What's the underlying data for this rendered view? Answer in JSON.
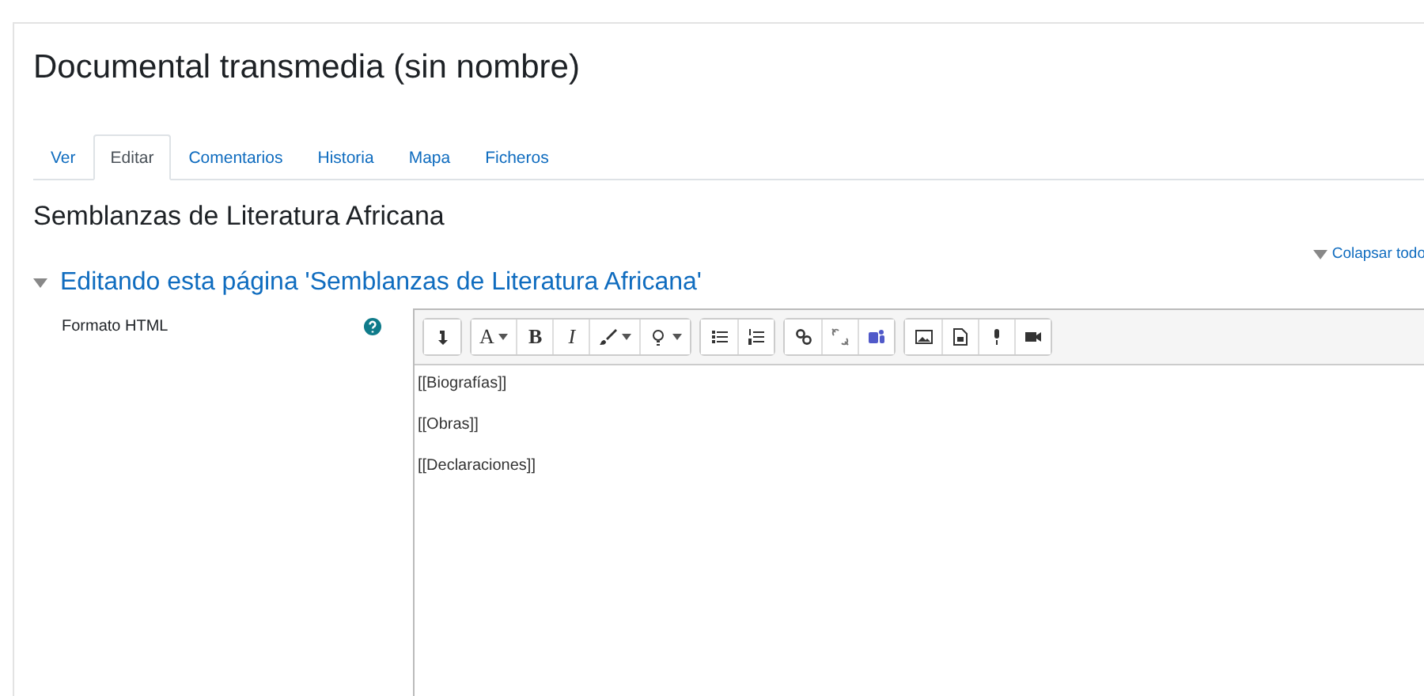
{
  "page_title": "Documental transmedia (sin nombre)",
  "tabs": [
    {
      "label": "Ver",
      "selected": false
    },
    {
      "label": "Editar",
      "selected": true
    },
    {
      "label": "Comentarios",
      "selected": false
    },
    {
      "label": "Historia",
      "selected": false
    },
    {
      "label": "Mapa",
      "selected": false
    },
    {
      "label": "Ficheros",
      "selected": false
    }
  ],
  "section_title": "Semblanzas de Literatura Africana",
  "collapse_link": "Colapsar todo",
  "fieldset": {
    "legend": "Editando esta página 'Semblanzas de Literatura Africana'",
    "expanded": true
  },
  "field": {
    "label": "Formato HTML",
    "toolbar": [
      [
        {
          "kind": "expand"
        }
      ],
      [
        {
          "kind": "font",
          "label": "A",
          "dropdown": true
        },
        {
          "kind": "bold",
          "label": "B",
          "dropdown": false
        },
        {
          "kind": "italic",
          "label": "I",
          "dropdown": false
        },
        {
          "kind": "brush",
          "dropdown": true
        },
        {
          "kind": "bulb",
          "dropdown": true
        }
      ],
      [
        {
          "kind": "bullets"
        },
        {
          "kind": "numbers"
        }
      ],
      [
        {
          "kind": "link"
        },
        {
          "kind": "unlink"
        },
        {
          "kind": "teams"
        }
      ],
      [
        {
          "kind": "image"
        },
        {
          "kind": "media"
        },
        {
          "kind": "mic"
        },
        {
          "kind": "video"
        }
      ]
    ],
    "content": [
      "[[Biografías]]",
      "[[Obras]]",
      "[[Declaraciones]]"
    ]
  }
}
